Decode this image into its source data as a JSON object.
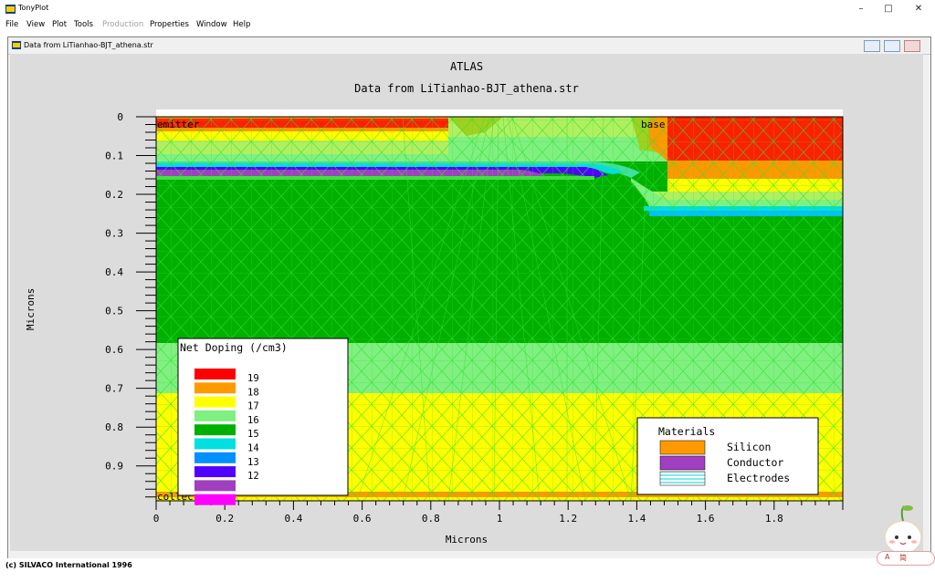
{
  "app": {
    "title": "TonyPlot",
    "window_controls": {
      "minimize": "–",
      "maximize": "□",
      "close": "✕"
    }
  },
  "menu": [
    {
      "label": "File",
      "enabled": true
    },
    {
      "label": "View",
      "enabled": true
    },
    {
      "label": "Plot",
      "enabled": true
    },
    {
      "label": "Tools",
      "enabled": true
    },
    {
      "label": "Production",
      "enabled": false
    },
    {
      "label": "Properties",
      "enabled": true
    },
    {
      "label": "Window",
      "enabled": true
    },
    {
      "label": "Help",
      "enabled": true
    }
  ],
  "document": {
    "title": "Data from LiTianhao-BJT_athena.str"
  },
  "plot": {
    "title": "ATLAS",
    "subtitle": "Data from LiTianhao-BJT_athena.str",
    "xlabel": "Microns",
    "ylabel": "Microns",
    "x_ticks": [
      "0",
      "0.2",
      "0.4",
      "0.6",
      "0.8",
      "1",
      "1.2",
      "1.4",
      "1.6",
      "1.8"
    ],
    "y_ticks": [
      "0",
      "0.1",
      "0.2",
      "0.3",
      "0.4",
      "0.5",
      "0.6",
      "0.7",
      "0.8",
      "0.9"
    ],
    "xlim": [
      0,
      2.0
    ],
    "ylim": [
      0,
      0.99
    ],
    "electrode_labels": {
      "emitter": "emitter",
      "base": "base",
      "collector": "collector"
    },
    "doping_legend": {
      "title": "Net Doping (/cm3)",
      "entries": [
        {
          "label": "19",
          "color": "#ff0000"
        },
        {
          "label": "18",
          "color": "#ff9900"
        },
        {
          "label": "17",
          "color": "#ffff00"
        },
        {
          "label": "16",
          "color": "#80f080"
        },
        {
          "label": "15",
          "color": "#00b000"
        },
        {
          "label": "14",
          "color": "#00e0e0"
        },
        {
          "label": "13",
          "color": "#0090ff"
        },
        {
          "label": "12",
          "color": "#5000ff"
        },
        {
          "label": "",
          "color": "#a040c0"
        },
        {
          "label": "",
          "color": "#ff00ff"
        }
      ]
    },
    "materials_legend": {
      "title": "Materials",
      "entries": [
        {
          "label": "Silicon",
          "color": "#ff9900"
        },
        {
          "label": "Conductor",
          "color": "#a040c0"
        },
        {
          "label": "Electrodes",
          "color": "#e0ffff"
        }
      ]
    }
  },
  "status": {
    "copyright": "(c) SILVACO International 1996"
  },
  "ime": {
    "mode": "A",
    "lang": "简"
  }
}
